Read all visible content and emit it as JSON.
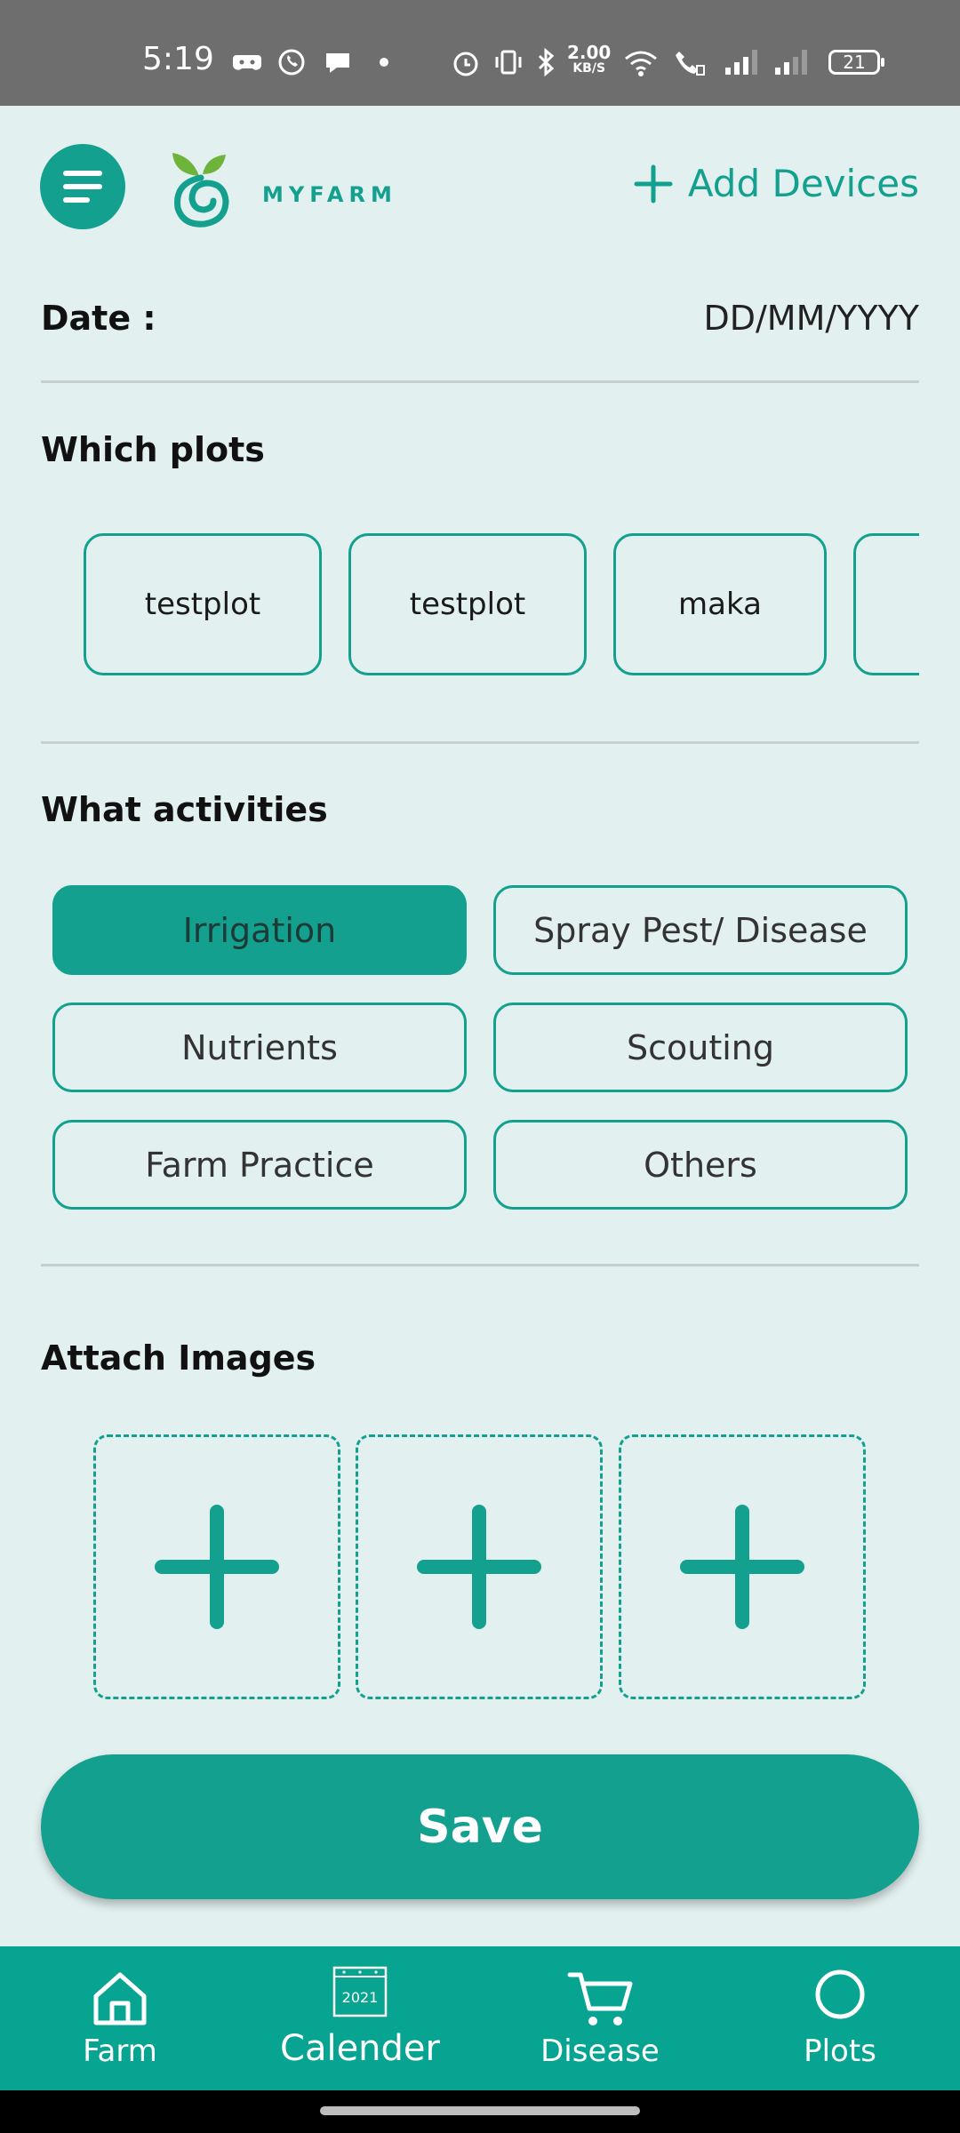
{
  "status_bar": {
    "time": "5:19",
    "net_speed_value": "2.00",
    "net_speed_unit": "KB/S",
    "battery": "21"
  },
  "header": {
    "logo_text": "MYFARM",
    "add_devices_label": "Add Devices"
  },
  "date": {
    "label": "Date :",
    "value": "DD/MM/YYYY"
  },
  "plots": {
    "title": "Which plots",
    "items": [
      "testplot",
      "testplot",
      "maka",
      ""
    ]
  },
  "activities": {
    "title": "What activities",
    "items": [
      "Irrigation",
      "Spray Pest/ Disease",
      "Nutrients",
      "Scouting",
      "Farm Practice",
      "Others"
    ],
    "selected": "Irrigation"
  },
  "images": {
    "title": "Attach Images"
  },
  "save_label": "Save",
  "bottom_nav": {
    "items": [
      "Farm",
      "Calender",
      "Disease",
      "Plots"
    ],
    "calendar_year": "2021",
    "active": "Calender"
  },
  "colors": {
    "accent": "#13a08f",
    "nav_background": "#07a491",
    "page_background": "#e2f0ef"
  }
}
